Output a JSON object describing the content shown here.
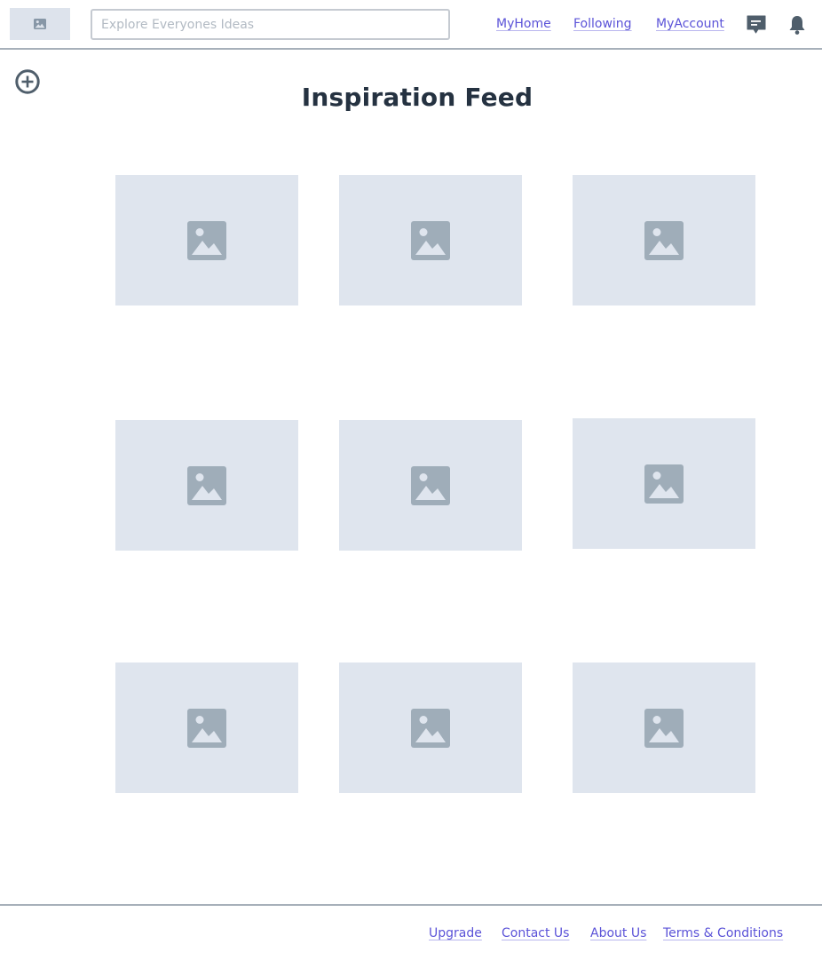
{
  "header": {
    "logo_icon": "image-icon",
    "search": {
      "placeholder": "Explore Everyones Ideas",
      "value": ""
    },
    "nav": {
      "myhome": "MyHome",
      "following": "Following",
      "myaccount": "MyAccount"
    },
    "icons": {
      "messages": "message-icon",
      "notifications": "bell-icon"
    }
  },
  "add_button_icon": "plus-circle-icon",
  "page_title": "Inspiration Feed",
  "feed": {
    "tile_icon": "image-placeholder-icon",
    "tile_count": 9
  },
  "footer": {
    "upgrade": "Upgrade",
    "contact": "Contact Us",
    "about": "About Us",
    "terms": "Terms & Conditions"
  },
  "colors": {
    "link": "#5b53d8",
    "tile_bg": "#dfe5ee",
    "tile_icon": "#9fadb9",
    "text_dark": "#253241",
    "divider": "#a7b0ba"
  }
}
